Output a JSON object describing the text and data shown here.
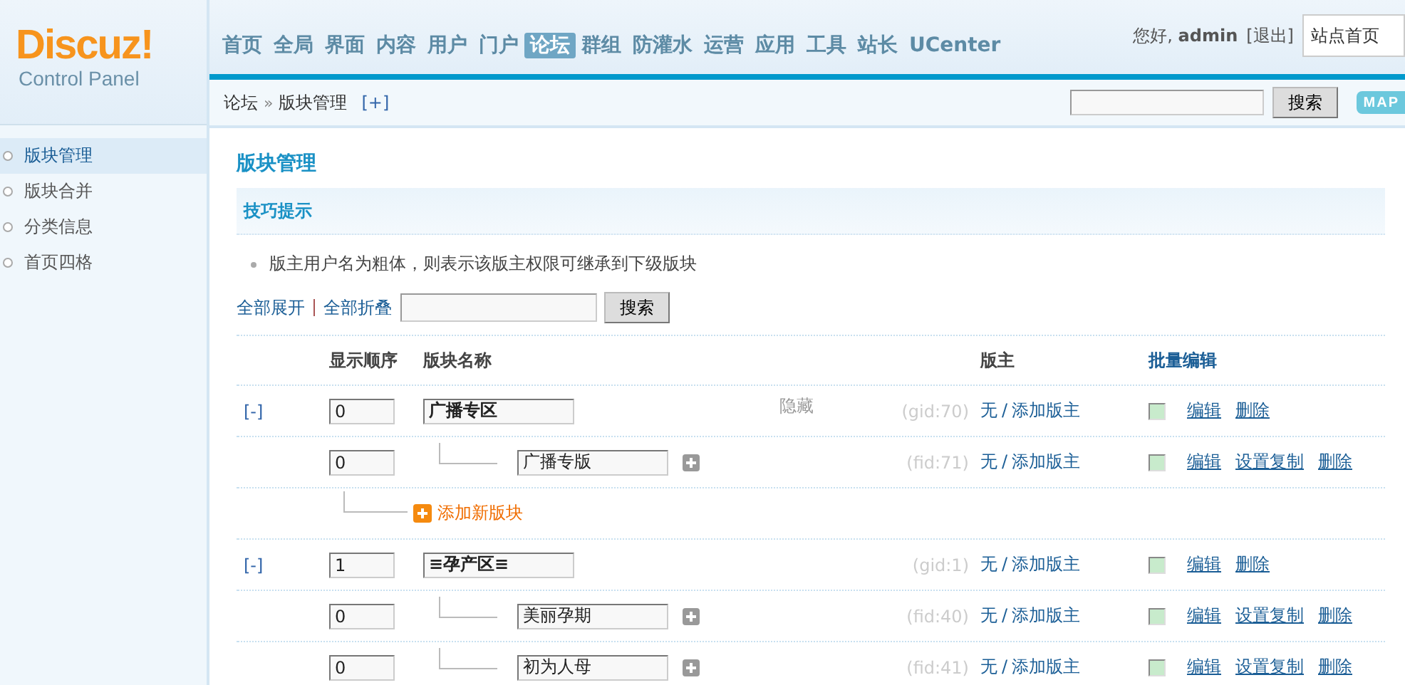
{
  "logo": {
    "brand": "Discuz!",
    "subtitle": "Control Panel"
  },
  "nav": [
    {
      "label": "首页",
      "selected": false
    },
    {
      "label": "全局",
      "selected": false
    },
    {
      "label": "界面",
      "selected": false
    },
    {
      "label": "内容",
      "selected": false
    },
    {
      "label": "用户",
      "selected": false
    },
    {
      "label": "门户",
      "selected": false
    },
    {
      "label": "论坛",
      "selected": true
    },
    {
      "label": "群组",
      "selected": false
    },
    {
      "label": "防灌水",
      "selected": false
    },
    {
      "label": "运营",
      "selected": false
    },
    {
      "label": "应用",
      "selected": false
    },
    {
      "label": "工具",
      "selected": false
    },
    {
      "label": "站长",
      "selected": false
    },
    {
      "label": "UCenter",
      "selected": false
    }
  ],
  "user": {
    "greeting": "您好, ",
    "name": "admin",
    "logout": "[退出]",
    "site_select": "站点首页"
  },
  "breadcrumb": {
    "root": "论坛",
    "separator": "»",
    "current": "版块管理",
    "add": "[+]"
  },
  "top_search": {
    "button": "搜索",
    "map": "MAP"
  },
  "sidebar": {
    "items": [
      {
        "label": "版块管理",
        "selected": true
      },
      {
        "label": "版块合并",
        "selected": false
      },
      {
        "label": "分类信息",
        "selected": false
      },
      {
        "label": "首页四格",
        "selected": false
      }
    ]
  },
  "page_title": "版块管理",
  "tips": {
    "title": "技巧提示",
    "items": [
      "版主用户名为粗体，则表示该版主权限可继承到下级版块"
    ]
  },
  "toolbar": {
    "expand_all": "全部展开",
    "collapse_all": "全部折叠",
    "search_button": "搜索"
  },
  "table": {
    "columns": [
      "显示顺序",
      "版块名称",
      "版主",
      "批量编辑"
    ],
    "rows": [
      {
        "kind": "group",
        "toggle": "[-]",
        "order": "0",
        "name": "广播专区",
        "hidden": "隐藏",
        "id": "(gid:70)",
        "moderator": "无",
        "separator": "/",
        "add_moderator": "添加版主",
        "checked": false,
        "actions": [
          "编辑",
          "删除"
        ]
      },
      {
        "kind": "forum",
        "order": "0",
        "name": "广播专版",
        "id": "(fid:71)",
        "moderator": "无",
        "separator": "/",
        "add_moderator": "添加版主",
        "checked": false,
        "actions": [
          "编辑",
          "设置复制",
          "删除"
        ]
      },
      {
        "kind": "add",
        "label": "添加新版块"
      },
      {
        "kind": "group",
        "toggle": "[-]",
        "order": "1",
        "name": "≡孕产区≡",
        "id": "(gid:1)",
        "moderator": "无",
        "separator": "/",
        "add_moderator": "添加版主",
        "checked": false,
        "actions": [
          "编辑",
          "删除"
        ]
      },
      {
        "kind": "forum",
        "order": "0",
        "name": "美丽孕期",
        "id": "(fid:40)",
        "moderator": "无",
        "separator": "/",
        "add_moderator": "添加版主",
        "checked": false,
        "actions": [
          "编辑",
          "设置复制",
          "删除"
        ]
      },
      {
        "kind": "forum",
        "order": "0",
        "name": "初为人母",
        "id": "(fid:41)",
        "moderator": "无",
        "separator": "/",
        "add_moderator": "添加版主",
        "checked": false,
        "actions": [
          "编辑",
          "设置复制",
          "删除"
        ]
      }
    ]
  }
}
